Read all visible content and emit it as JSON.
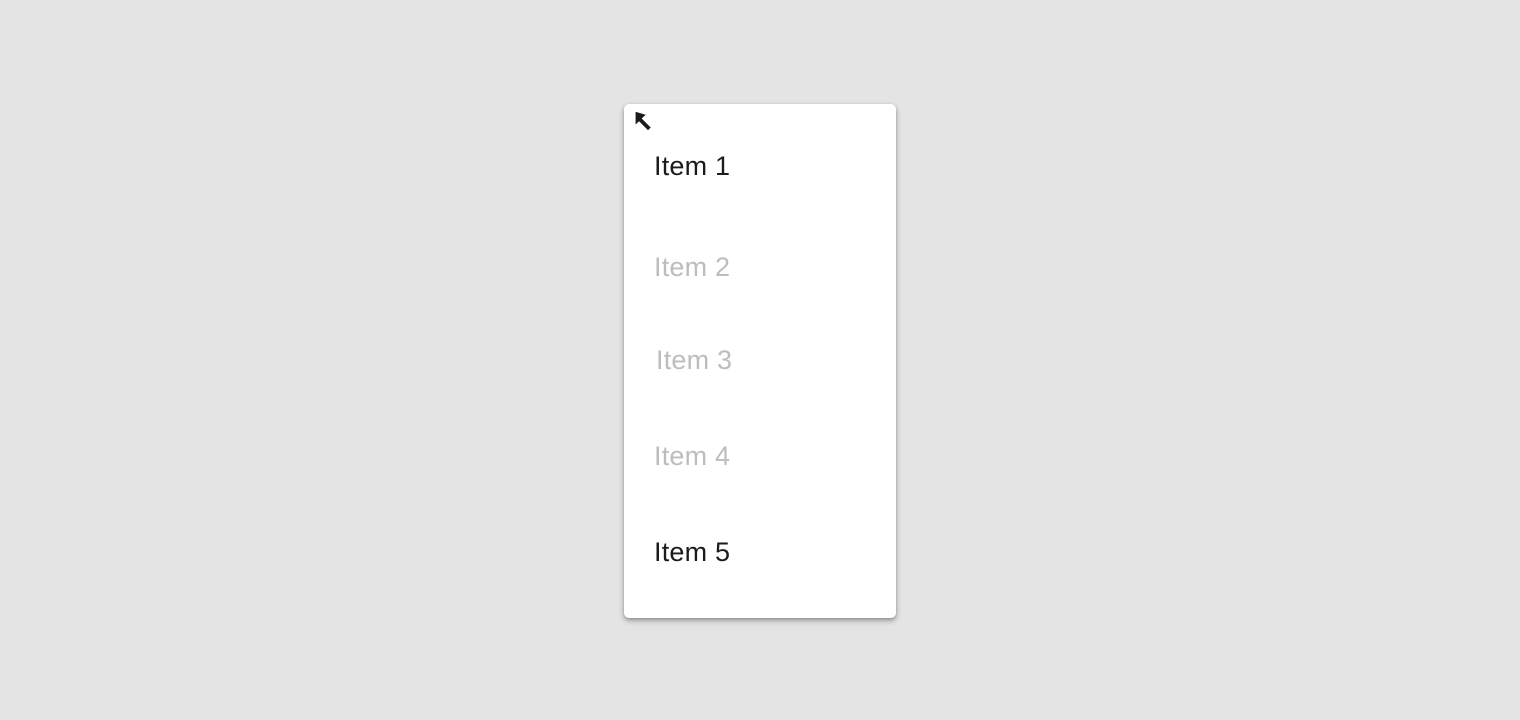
{
  "menu": {
    "items": [
      {
        "label": "Item 1",
        "state": "enabled"
      },
      {
        "label": "Item 2",
        "state": "disabled"
      },
      {
        "label": "Item 3",
        "state": "disabled"
      },
      {
        "label": "Item 4",
        "state": "disabled"
      },
      {
        "label": "Item 5",
        "state": "enabled"
      }
    ]
  },
  "pointer": {
    "icon": "arrow-cursor-icon"
  },
  "colors": {
    "background": "#e4e4e4",
    "menu_surface": "#ffffff",
    "enabled_text": "#1b1b1b",
    "disabled_text": "#bdbdbd"
  }
}
